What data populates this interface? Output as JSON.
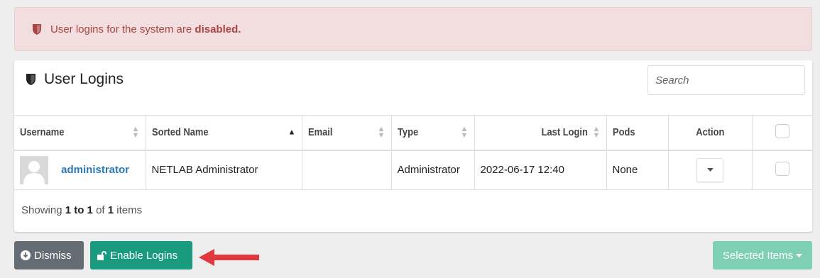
{
  "alert": {
    "text": "User logins for the system are ",
    "emphasis": "disabled."
  },
  "panel": {
    "title": "User Logins",
    "search_placeholder": "Search"
  },
  "table": {
    "columns": [
      "Username",
      "Sorted Name",
      "Email",
      "Type",
      "Last Login",
      "Pods",
      "Action"
    ],
    "rows": [
      {
        "username": "administrator",
        "sorted_name": "NETLAB Administrator",
        "email": "",
        "type": "Administrator",
        "last_login": "2022-06-17 12:40",
        "pods": "None"
      }
    ]
  },
  "footer": {
    "showing": "Showing",
    "range": "1 to 1",
    "of": "of",
    "total": "1",
    "items": "items"
  },
  "buttons": {
    "dismiss": "Dismiss",
    "enable_logins": "Enable Logins",
    "selected_items": "Selected Items"
  },
  "colors": {
    "alert_bg": "#f2dede",
    "alert_text": "#a94442",
    "link": "#2a7ab8",
    "dismiss_bg": "#666c73",
    "enable_bg": "#1a9a7e",
    "selected_bg": "#7fcfb4",
    "annotation_arrow": "#e0383c"
  }
}
